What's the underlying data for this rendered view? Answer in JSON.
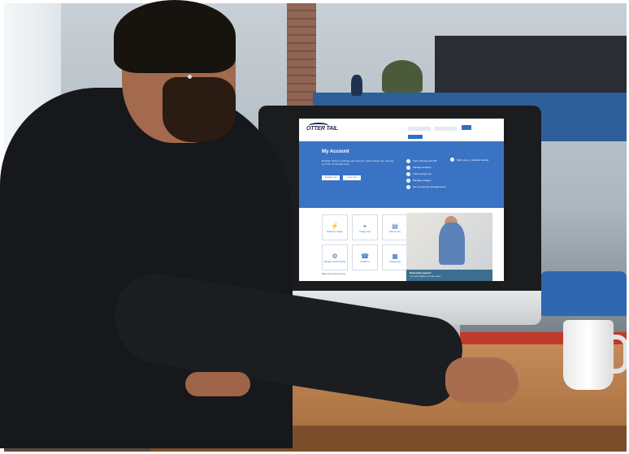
{
  "screen": {
    "logo_text": "OTTER TAIL",
    "login_label": "Login",
    "hero": {
      "title": "My Account",
      "text": "Register today to manage your account, track energy use, and pay your bill. It's all right here!",
      "register_label": "Register now",
      "learn_label": "Learn more"
    },
    "checklist": [
      "View and pay your bill",
      "Manage autopay",
      "Track energy use",
      "Manage outages",
      "Set up payment arrangements"
    ],
    "checklist_extra": "Start, stop, or transfer service",
    "tiles": [
      {
        "label": "Report an outage",
        "icon": "outage-icon"
      },
      {
        "label": "Outage map",
        "icon": "map-icon"
      },
      {
        "label": "Start service",
        "icon": "document-icon"
      },
      {
        "label": "Manage account activity",
        "icon": "activity-icon"
      },
      {
        "label": "Contact us",
        "icon": "phone-icon"
      },
      {
        "label": "Outage page",
        "icon": "outage-page-icon"
      }
    ],
    "help": {
      "title": "Need help paying?",
      "text": "Let's work together to make a plan."
    },
    "footer": "Make your account secure"
  },
  "colors": {
    "brand_blue": "#3a73c4",
    "desk_wood": "#b27745",
    "shirt": "#16181b"
  }
}
